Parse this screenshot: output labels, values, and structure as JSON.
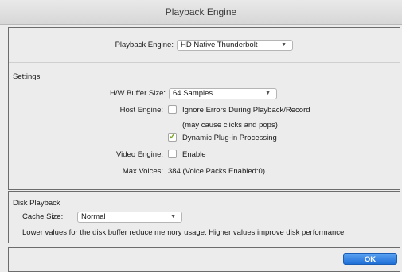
{
  "window": {
    "title": "Playback Engine"
  },
  "engine": {
    "label": "Playback Engine:",
    "value": "HD Native Thunderbolt"
  },
  "settings": {
    "heading": "Settings",
    "buffer": {
      "label": "H/W Buffer Size:",
      "value": "64 Samples"
    },
    "host": {
      "label": "Host Engine:",
      "ignore_errors": {
        "label": "Ignore Errors During Playback/Record",
        "checked": false
      },
      "ignore_note": "(may cause clicks and pops)",
      "dynamic": {
        "label": "Dynamic Plug-in Processing",
        "checked": true
      }
    },
    "video": {
      "label": "Video Engine:",
      "enable_label": "Enable",
      "checked": false
    },
    "voices": {
      "label": "Max Voices:",
      "value": "384 (Voice Packs Enabled:0)"
    }
  },
  "disk": {
    "heading": "Disk Playback",
    "cache": {
      "label": "Cache Size:",
      "value": "Normal"
    },
    "note": "Lower values for the disk buffer reduce memory usage.  Higher values improve disk performance."
  },
  "buttons": {
    "ok": "OK"
  },
  "colors": {
    "accent": "#1f6fd6",
    "check": "#7aa82b"
  }
}
